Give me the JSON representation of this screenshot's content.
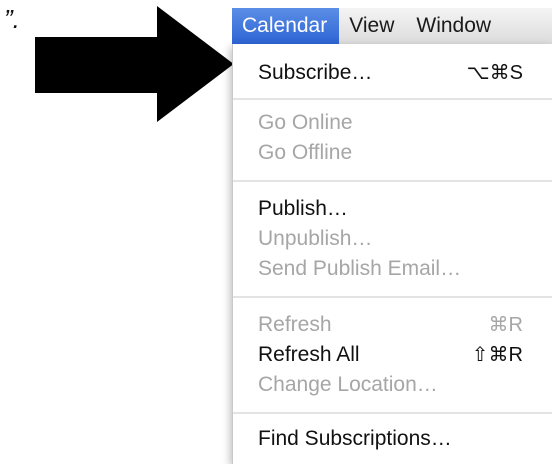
{
  "annotation": {
    "quote_mark": "”."
  },
  "menubar": {
    "items": [
      {
        "label": "Calendar",
        "active": true
      },
      {
        "label": "View",
        "active": false
      },
      {
        "label": "Window",
        "active": false
      }
    ]
  },
  "menu": {
    "items": [
      {
        "label": "Subscribe…",
        "shortcut": "⌥⌘S",
        "enabled": true
      },
      {
        "label": "Go Online",
        "shortcut": "",
        "enabled": false
      },
      {
        "label": "Go Offline",
        "shortcut": "",
        "enabled": false
      },
      {
        "label": "Publish…",
        "shortcut": "",
        "enabled": true
      },
      {
        "label": "Unpublish…",
        "shortcut": "",
        "enabled": false
      },
      {
        "label": "Send Publish Email…",
        "shortcut": "",
        "enabled": false
      },
      {
        "label": "Refresh",
        "shortcut": "⌘R",
        "enabled": false
      },
      {
        "label": "Refresh All",
        "shortcut": "⇧⌘R",
        "enabled": true
      },
      {
        "label": "Change Location…",
        "shortcut": "",
        "enabled": false
      },
      {
        "label": "Find Subscriptions…",
        "shortcut": "",
        "enabled": true
      }
    ]
  },
  "colors": {
    "highlight": "#3a6fd8",
    "arrow": "#000000",
    "disabled_text": "#a6a6a6"
  }
}
